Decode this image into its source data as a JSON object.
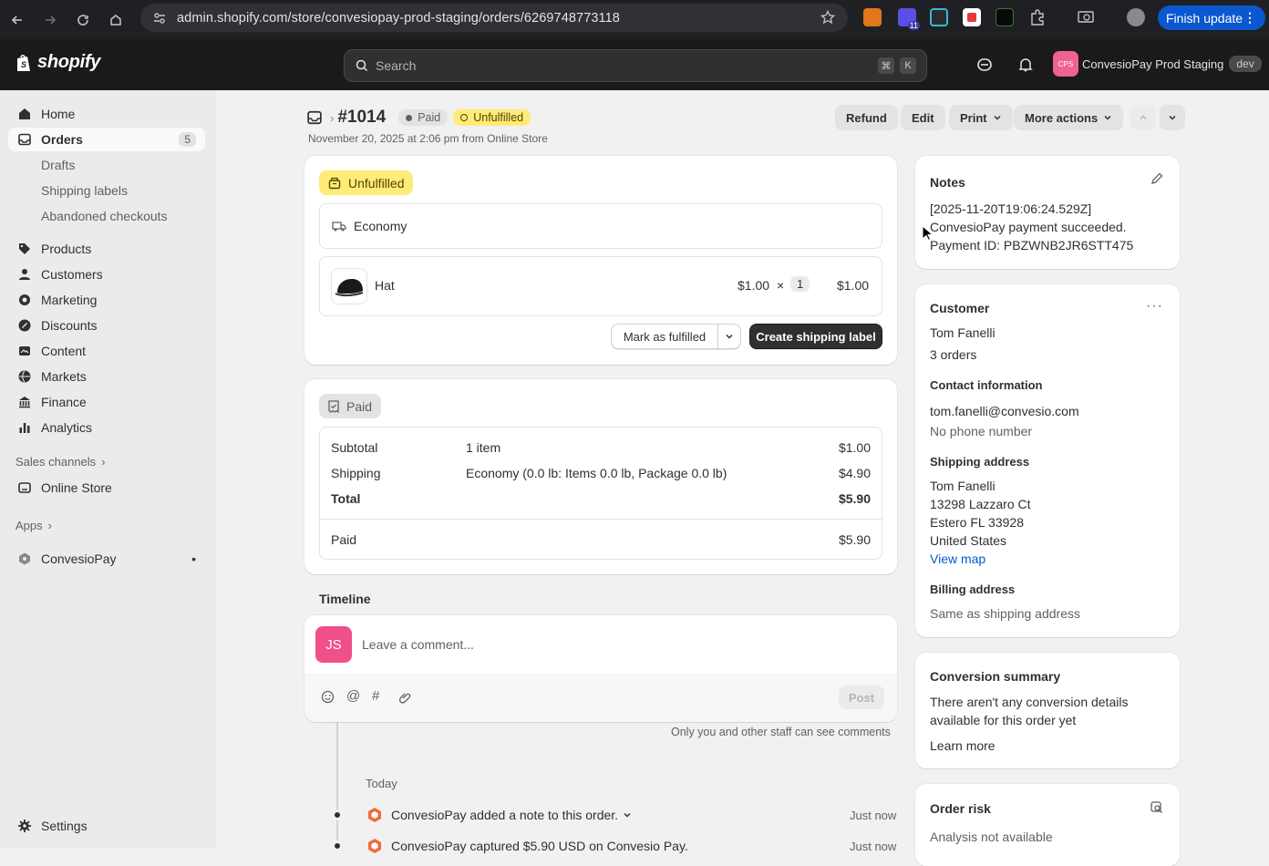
{
  "browser": {
    "url": "admin.shopify.com/store/convesiopay-prod-staging/orders/6269748773118",
    "finish_update": "Finish update",
    "ext_badge": "11"
  },
  "topbar": {
    "logo_text": "shopify",
    "search_placeholder": "Search",
    "kbd1": "⌘",
    "kbd2": "K",
    "store_initials": "CPS",
    "store_name": "ConvesioPay Prod Staging",
    "store_badge": "dev"
  },
  "sidebar": {
    "home": "Home",
    "orders": "Orders",
    "orders_count": "5",
    "drafts": "Drafts",
    "shipping_labels": "Shipping labels",
    "abandoned": "Abandoned checkouts",
    "products": "Products",
    "customers": "Customers",
    "marketing": "Marketing",
    "discounts": "Discounts",
    "content": "Content",
    "markets": "Markets",
    "finance": "Finance",
    "analytics": "Analytics",
    "sales_channels": "Sales channels",
    "online_store": "Online Store",
    "apps": "Apps",
    "convesiopay": "ConvesioPay",
    "settings": "Settings"
  },
  "order": {
    "number": "#1014",
    "paid_badge": "Paid",
    "unfulfilled_badge": "Unfulfilled",
    "subtitle": "November 20, 2025 at 2:06 pm from Online Store",
    "refund": "Refund",
    "edit": "Edit",
    "print": "Print",
    "more_actions": "More actions"
  },
  "fulfillment": {
    "status": "Unfulfilled",
    "shipping_method": "Economy",
    "item_name": "Hat",
    "item_price": "$1.00",
    "times": "×",
    "item_qty": "1",
    "item_total": "$1.00",
    "mark_fulfilled": "Mark as fulfilled",
    "create_label": "Create shipping label"
  },
  "payment": {
    "status": "Paid",
    "subtotal_label": "Subtotal",
    "subtotal_desc": "1 item",
    "subtotal_value": "$1.00",
    "shipping_label": "Shipping",
    "shipping_desc": "Economy (0.0 lb: Items 0.0 lb, Package 0.0 lb)",
    "shipping_value": "$4.90",
    "total_label": "Total",
    "total_value": "$5.90",
    "paid_label": "Paid",
    "paid_value": "$5.90"
  },
  "timeline": {
    "title": "Timeline",
    "avatar": "JS",
    "comment_placeholder": "Leave a comment...",
    "post": "Post",
    "staff_note": "Only you and other staff can see comments",
    "day": "Today",
    "event1": "ConvesioPay added a note to this order.",
    "event1_time": "Just now",
    "event2": "ConvesioPay captured $5.90 USD on Convesio Pay.",
    "event2_time": "Just now"
  },
  "notes": {
    "title": "Notes",
    "line1": "[2025-11-20T19:06:24.529Z]",
    "line2": "ConvesioPay payment succeeded.",
    "line3": "Payment ID: PBZWNB2JR6STT475"
  },
  "customer": {
    "title": "Customer",
    "name": "Tom Fanelli",
    "orders": "3 orders",
    "contact_title": "Contact information",
    "email": "tom.fanelli@convesio.com",
    "phone": "No phone number",
    "shipping_title": "Shipping address",
    "addr1": "Tom Fanelli",
    "addr2": "13298 Lazzaro Ct",
    "addr3": "Estero FL 33928",
    "addr4": "United States",
    "view_map": "View map",
    "billing_title": "Billing address",
    "billing_value": "Same as shipping address"
  },
  "conversion": {
    "title": "Conversion summary",
    "line1": "There aren't any conversion details",
    "line2": "available for this order yet",
    "learn_more": "Learn more"
  },
  "risk": {
    "title": "Order risk",
    "value": "Analysis not available"
  }
}
